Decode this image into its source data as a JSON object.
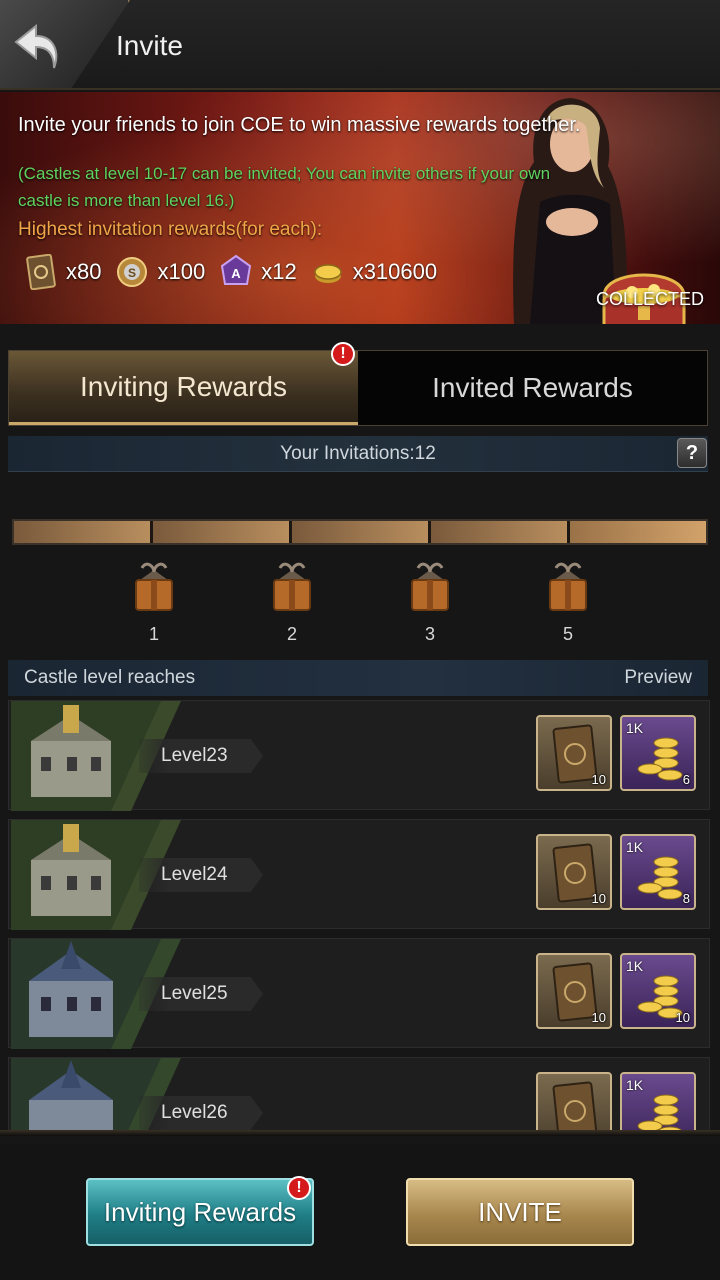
{
  "header": {
    "title": "Invite"
  },
  "banner": {
    "headline": "Invite your friends to join COE to win massive rewards together.",
    "note": "(Castles at level 10-17 can be invited; You can invite others if your own castle is more than level 16.)",
    "highest": "Highest invitation rewards(for each):",
    "rewards": [
      {
        "icon": "card-icon",
        "value": "x80"
      },
      {
        "icon": "silver-coin-icon",
        "value": "x100"
      },
      {
        "icon": "gem-a-icon",
        "value": "x12"
      },
      {
        "icon": "gold-coin-icon",
        "value": "x310600"
      }
    ],
    "status": "COLLECTED"
  },
  "tabs": [
    {
      "label": "Inviting Rewards",
      "active": true
    },
    {
      "label": "Invited Rewards",
      "active": false
    }
  ],
  "alert_mark": "!",
  "invitations_text": "Your Invitations:12",
  "help_label": "?",
  "milestones": [
    "1",
    "2",
    "3",
    "5"
  ],
  "list_header": {
    "left": "Castle level reaches",
    "right": "Preview"
  },
  "rows": [
    {
      "level": "Level23",
      "book_qty": "10",
      "gold_tag": "1K",
      "gold_qty": "6"
    },
    {
      "level": "Level24",
      "book_qty": "10",
      "gold_tag": "1K",
      "gold_qty": "8"
    },
    {
      "level": "Level25",
      "book_qty": "10",
      "gold_tag": "1K",
      "gold_qty": "10"
    },
    {
      "level": "Level26",
      "book_qty": "",
      "gold_tag": "1K",
      "gold_qty": ""
    }
  ],
  "footer": {
    "left_button": "Inviting Rewards",
    "right_button": "INVITE"
  },
  "colors": {
    "accent_gold": "#c9a86a",
    "note_green": "#5fd35f",
    "highlight_orange": "#f0a648",
    "teal_button": "#1f7e86"
  }
}
